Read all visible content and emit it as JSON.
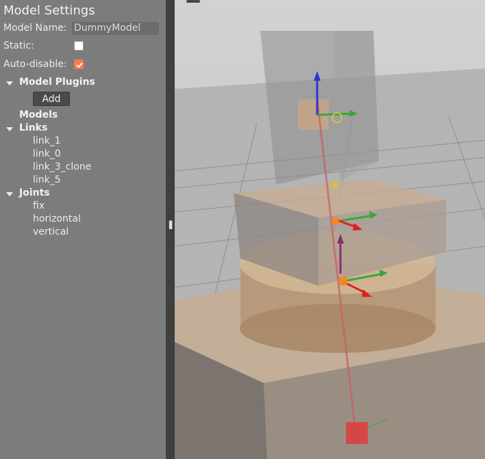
{
  "model_settings": {
    "title": "Model Settings",
    "model_name_label": "Model Name:",
    "model_name_value": "DummyModel",
    "static_label": "Static:",
    "static_checked": false,
    "auto_disable_label": "Auto-disable:",
    "auto_disable_checked": true
  },
  "tree": {
    "model_plugins": {
      "label": "Model Plugins",
      "add_label": "Add"
    },
    "models": {
      "label": "Models"
    },
    "links": {
      "label": "Links",
      "items": [
        "link_1",
        "link_0",
        "link_3_clone",
        "link_5"
      ]
    },
    "joints": {
      "label": "Joints",
      "items": [
        "fix",
        "horizontal",
        "vertical"
      ]
    }
  },
  "colors": {
    "panel_bg": "#7c7c7c",
    "accent": "#f47c4a",
    "viewport_sky": "#c8c8c8",
    "link_tint": "#c8a07a"
  },
  "icons": {
    "expand": "chevron-down-icon",
    "checkmark": "check-icon",
    "splitter": "grip-icon"
  }
}
